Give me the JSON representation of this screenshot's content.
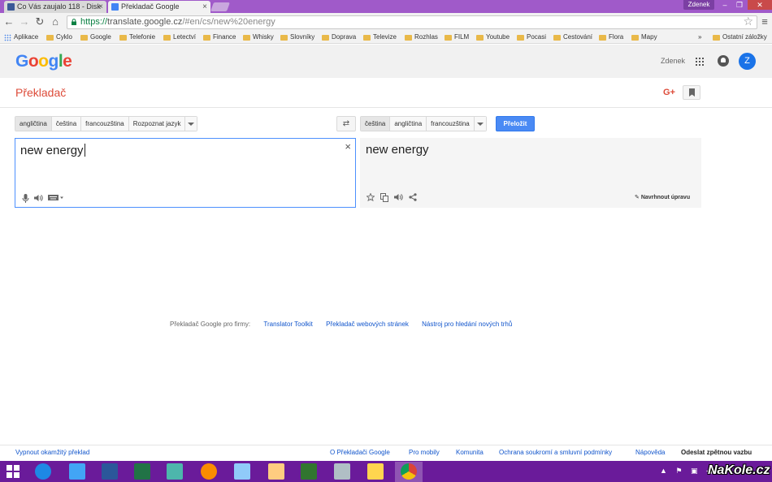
{
  "browser": {
    "tabs": [
      {
        "title": "Co Vás zaujalo 118 - Disk",
        "close": "×"
      },
      {
        "title": "Překladač Google",
        "close": "×"
      }
    ],
    "profile": "Zdenek",
    "window_controls": {
      "minimize": "–",
      "restore": "❐",
      "close": "✕"
    },
    "nav": {
      "back": "←",
      "forward": "→",
      "reload": "↻",
      "home": "⌂"
    },
    "url": {
      "scheme": "https://",
      "host": "translate.google.cz",
      "path": "/#en/cs/new%20energy"
    },
    "star": "☆",
    "menu": "≡"
  },
  "bookmarks": [
    "Aplikace",
    "Cyklo",
    "Google",
    "Telefonie",
    "Letectví",
    "Finance",
    "Whisky",
    "Slovníky",
    "Doprava",
    "Televize",
    "Rozhlas",
    "FILM",
    "Youtube",
    "Pocasi",
    "Cestování",
    "Flora",
    "Mapy"
  ],
  "bookmarks_more": "»",
  "bookmarks_other": "Ostatní záložky",
  "google": {
    "logo_letters": [
      "G",
      "o",
      "o",
      "g",
      "l",
      "e"
    ],
    "logo_colors": [
      "#4285f4",
      "#ea4335",
      "#fbbc05",
      "#4285f4",
      "#34a853",
      "#ea4335"
    ],
    "account_name": "Zdenek",
    "avatar_letter": "Z"
  },
  "translate": {
    "product_title": "Překladač",
    "gplus": "G+",
    "source_langs": [
      "angličtina",
      "čeština",
      "francouzština",
      "Rozpoznat jazyk"
    ],
    "target_langs": [
      "čeština",
      "angličtina",
      "francouzština"
    ],
    "swap": "⇄",
    "translate_button": "Přeložit",
    "source_text": "new energy",
    "clear": "×",
    "result_text": "new energy",
    "suggest_edit": "Navrhnout úpravu"
  },
  "business": {
    "label": "Překladač Google pro firmy:",
    "links": [
      "Translator Toolkit",
      "Překladač webových stránek",
      "Nástroj pro hledání nových trhů"
    ]
  },
  "footer": {
    "left": "Vypnout okamžitý překlad",
    "links": [
      "O Překladači Google",
      "Pro mobily",
      "Komunita",
      "Ochrana soukromí a smluvní podmínky",
      "Nápověda"
    ],
    "feedback": "Odeslat zpětnou vazbu"
  },
  "taskbar": {
    "apps": [
      "internet-explorer",
      "download-manager",
      "word",
      "excel",
      "paint-tool",
      "media-player",
      "app-a",
      "paint",
      "project",
      "calculator",
      "file-explorer",
      "chrome"
    ],
    "tray_icons": "▲ ⚑ ▣ ◀)"
  },
  "watermark": "NaKole.cz"
}
